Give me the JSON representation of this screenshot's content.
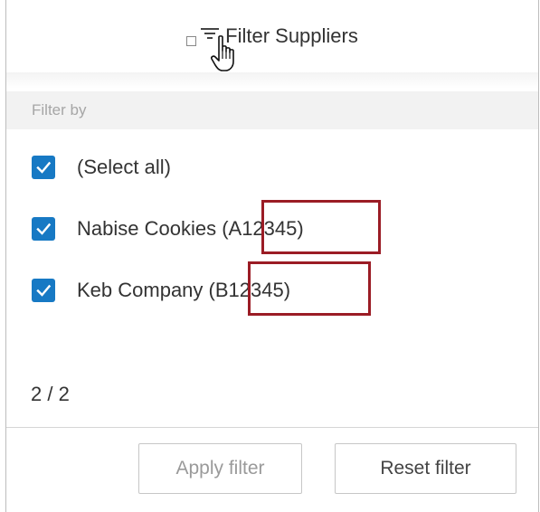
{
  "header": {
    "title": "Filter Suppliers",
    "filter_icon": "filter-lines-icon",
    "cursor_icon": "hand-pointer-icon"
  },
  "filter_by_label": "Filter by",
  "options": [
    {
      "label": "(Select all)",
      "checked": true
    },
    {
      "label_prefix": "Nabise Cookies ",
      "code": "(A12345)",
      "checked": true
    },
    {
      "label_prefix": "Keb Company ",
      "code": "(B12345)",
      "checked": true
    }
  ],
  "count_text": "2 / 2",
  "buttons": {
    "apply": "Apply filter",
    "reset": "Reset filter"
  },
  "colors": {
    "checkbox": "#1779c4",
    "highlight_box": "#9b1c25"
  }
}
